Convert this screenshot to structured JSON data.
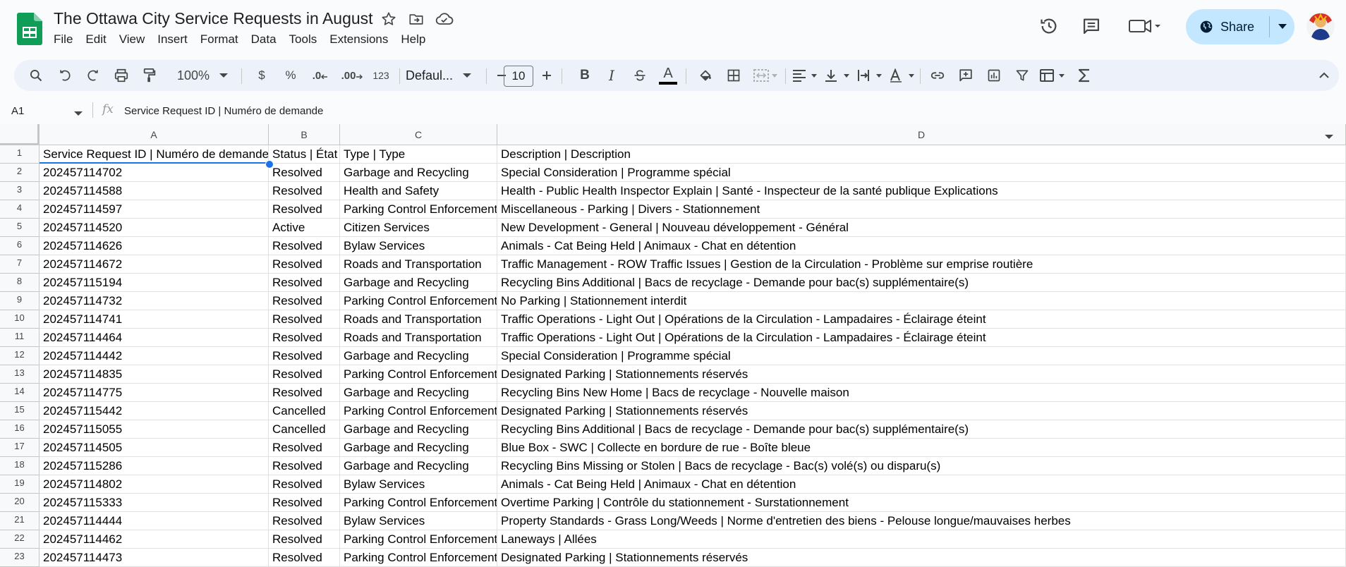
{
  "app": {
    "title": "The Ottawa City Service Requests in August",
    "menu": [
      "File",
      "Edit",
      "View",
      "Insert",
      "Format",
      "Data",
      "Tools",
      "Extensions",
      "Help"
    ],
    "share_label": "Share"
  },
  "toolbar": {
    "zoom": "100%",
    "currency": "$",
    "percent": "%",
    "dec_decrease": ".0",
    "dec_increase": ".00",
    "number_format": "123",
    "font": "Defaul...",
    "font_size": "10",
    "bold": "B",
    "italic": "I",
    "text_color_letter": "A",
    "text_color_bar": "#000000"
  },
  "formula_bar": {
    "name_box": "A1",
    "fx": "fx",
    "content": "Service Request ID | Numéro de demande"
  },
  "columns": [
    "A",
    "B",
    "C",
    "D"
  ],
  "rows": [
    {
      "n": "1",
      "a": "Service Request ID | Numéro de demande",
      "b": "Status | État",
      "c": "Type | Type",
      "d": "Description | Description"
    },
    {
      "n": "2",
      "a": "202457114702",
      "b": "Resolved",
      "c": "Garbage and Recycling",
      "d": "Special Consideration | Programme spécial"
    },
    {
      "n": "3",
      "a": "202457114588",
      "b": "Resolved",
      "c": "Health and Safety",
      "d": "Health - Public Health Inspector Explain | Santé - Inspecteur de la santé publique Explications"
    },
    {
      "n": "4",
      "a": "202457114597",
      "b": "Resolved",
      "c": "Parking Control Enforcement",
      "d": "Miscellaneous - Parking | Divers - Stationnement"
    },
    {
      "n": "5",
      "a": "202457114520",
      "b": "Active",
      "c": "Citizen Services",
      "d": "New Development - General | Nouveau développement -  Général"
    },
    {
      "n": "6",
      "a": "202457114626",
      "b": "Resolved",
      "c": "Bylaw Services",
      "d": "Animals - Cat Being Held | Animaux - Chat en détention"
    },
    {
      "n": "7",
      "a": "202457114672",
      "b": "Resolved",
      "c": "Roads and Transportation",
      "d": "Traffic Management - ROW Traffic Issues | Gestion de la Circulation -  Problème sur emprise routière"
    },
    {
      "n": "8",
      "a": "202457115194",
      "b": "Resolved",
      "c": "Garbage and Recycling",
      "d": "Recycling Bins Additional | Bacs de recyclage - Demande pour bac(s) supplémentaire(s)"
    },
    {
      "n": "9",
      "a": "202457114732",
      "b": "Resolved",
      "c": "Parking Control Enforcement",
      "d": "No Parking | Stationnement interdit"
    },
    {
      "n": "10",
      "a": "202457114741",
      "b": "Resolved",
      "c": "Roads and Transportation",
      "d": "Traffic Operations - Light Out | Opérations de la Circulation - Lampadaires - Éclairage éteint"
    },
    {
      "n": "11",
      "a": "202457114464",
      "b": "Resolved",
      "c": "Roads and Transportation",
      "d": "Traffic Operations - Light Out | Opérations de la Circulation - Lampadaires - Éclairage éteint"
    },
    {
      "n": "12",
      "a": "202457114442",
      "b": "Resolved",
      "c": "Garbage and Recycling",
      "d": "Special Consideration | Programme spécial"
    },
    {
      "n": "13",
      "a": "202457114835",
      "b": "Resolved",
      "c": "Parking Control Enforcement",
      "d": "Designated Parking | Stationnements réservés"
    },
    {
      "n": "14",
      "a": "202457114775",
      "b": "Resolved",
      "c": "Garbage and Recycling",
      "d": "Recycling Bins New Home | Bacs de recyclage - Nouvelle maison"
    },
    {
      "n": "15",
      "a": "202457115442",
      "b": "Cancelled",
      "c": "Parking Control Enforcement",
      "d": "Designated Parking | Stationnements réservés"
    },
    {
      "n": "16",
      "a": "202457115055",
      "b": "Cancelled",
      "c": "Garbage and Recycling",
      "d": "Recycling Bins Additional | Bacs de recyclage - Demande pour bac(s) supplémentaire(s)"
    },
    {
      "n": "17",
      "a": "202457114505",
      "b": "Resolved",
      "c": "Garbage and Recycling",
      "d": "Blue Box - SWC | Collecte en bordure de rue - Boîte bleue"
    },
    {
      "n": "18",
      "a": "202457115286",
      "b": "Resolved",
      "c": "Garbage and Recycling",
      "d": "Recycling Bins Missing or Stolen | Bacs de recyclage - Bac(s) volé(s) ou disparu(s)"
    },
    {
      "n": "19",
      "a": "202457114802",
      "b": "Resolved",
      "c": "Bylaw Services",
      "d": "Animals - Cat Being Held | Animaux - Chat en détention"
    },
    {
      "n": "20",
      "a": "202457115333",
      "b": "Resolved",
      "c": "Parking Control Enforcement",
      "d": "Overtime Parking | Contrôle du stationnement - Surstationnement"
    },
    {
      "n": "21",
      "a": "202457114444",
      "b": "Resolved",
      "c": "Bylaw Services",
      "d": "Property Standards - Grass Long/Weeds | Norme d'entretien des biens - Pelouse longue/mauvaises herbes"
    },
    {
      "n": "22",
      "a": "202457114462",
      "b": "Resolved",
      "c": "Parking Control Enforcement",
      "d": "Laneways | Allées"
    },
    {
      "n": "23",
      "a": "202457114473",
      "b": "Resolved",
      "c": "Parking Control Enforcement",
      "d": "Designated Parking | Stationnements réservés"
    }
  ],
  "colors": {
    "accent": "#1a73e8",
    "share_bg": "#c2e7ff",
    "toolbar_bg": "#edf2fa",
    "sheets_green": "#0f9d58"
  }
}
